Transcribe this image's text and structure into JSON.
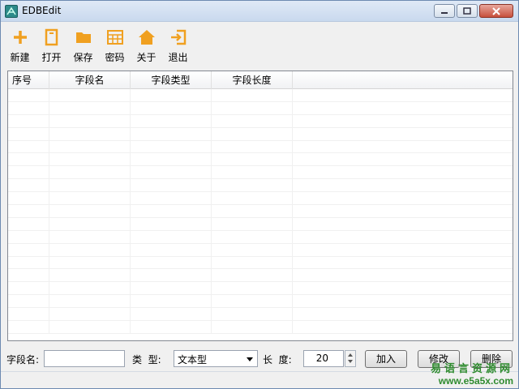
{
  "window": {
    "title": "EDBEdit"
  },
  "toolbar": {
    "items": [
      {
        "label": "新建",
        "icon": "plus-icon"
      },
      {
        "label": "打开",
        "icon": "open-file-icon"
      },
      {
        "label": "保存",
        "icon": "folder-icon"
      },
      {
        "label": "密码",
        "icon": "grid-icon"
      },
      {
        "label": "关于",
        "icon": "home-icon"
      },
      {
        "label": "退出",
        "icon": "exit-icon"
      }
    ],
    "icon_color": "#f0a020"
  },
  "table": {
    "columns": [
      "序号",
      "字段名",
      "字段类型",
      "字段长度"
    ],
    "rows": []
  },
  "form": {
    "field_name_label": "字段名:",
    "field_name_value": "",
    "type_label": "类  型:",
    "type_value": "文本型",
    "length_label": "长  度:",
    "length_value": "20",
    "add_label": "加入",
    "modify_label": "修改",
    "delete_label": "删除"
  },
  "watermark": {
    "text_cn": "易语言资源网",
    "url": "www.e5a5x.com"
  }
}
